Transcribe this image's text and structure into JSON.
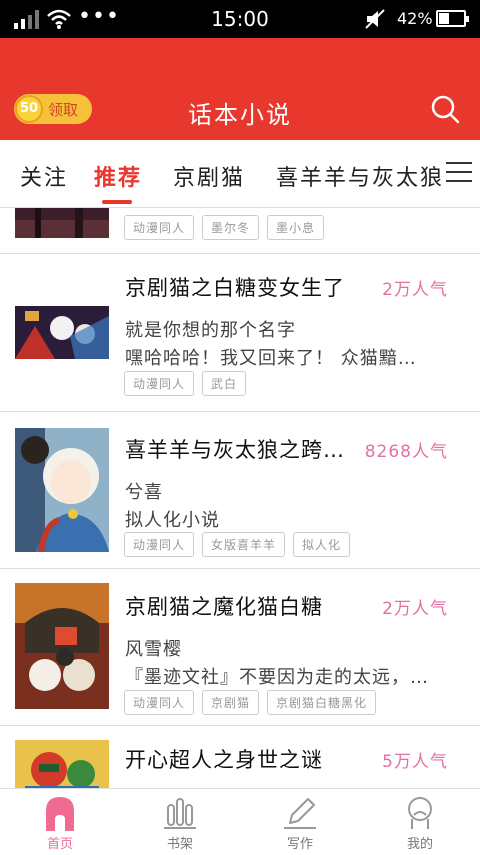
{
  "status_bar": {
    "time": "15:00",
    "battery": "42%",
    "battery_level": 0.42
  },
  "header": {
    "title": "话本小说",
    "coin_count": "50",
    "coin_label": "领取"
  },
  "tabs": [
    {
      "label": "关注"
    },
    {
      "label": "推荐"
    },
    {
      "label": "京剧猫"
    },
    {
      "label": "喜羊羊与灰太狼"
    }
  ],
  "feed": {
    "partial_top_tags": [
      "动漫同人",
      "墨尔冬",
      "墨小息"
    ],
    "items": [
      {
        "title": "京剧猫之白糖变女生了",
        "popularity": "2万人气",
        "author": "就是你想的那个名字",
        "desc": "嘿哈哈哈！我又回来了！ 众猫黯…",
        "tags": [
          "动漫同人",
          "武白"
        ]
      },
      {
        "title": "喜羊羊与灰太狼之跨…",
        "popularity": "8268人气",
        "author": "兮喜",
        "desc": "拟人化小说",
        "tags": [
          "动漫同人",
          "女版喜羊羊",
          "拟人化"
        ]
      },
      {
        "title": "京剧猫之魔化猫白糖",
        "popularity": "2万人气",
        "author": "风雪樱",
        "desc": "『墨迹文社』不要因为走的太远，…",
        "tags": [
          "动漫同人",
          "京剧猫",
          "京剧猫白糖黑化"
        ]
      },
      {
        "title": "开心超人之身世之谜",
        "popularity": "5万人气"
      }
    ]
  },
  "bottom_nav": [
    {
      "label": "首页",
      "icon": "home-icon"
    },
    {
      "label": "书架",
      "icon": "bookshelf-icon"
    },
    {
      "label": "写作",
      "icon": "pencil-icon"
    },
    {
      "label": "我的",
      "icon": "profile-icon"
    }
  ],
  "colors": {
    "header_red": "#e8372d",
    "popularity_pink": "#e56fa3",
    "nav_active": "#f06b92"
  }
}
